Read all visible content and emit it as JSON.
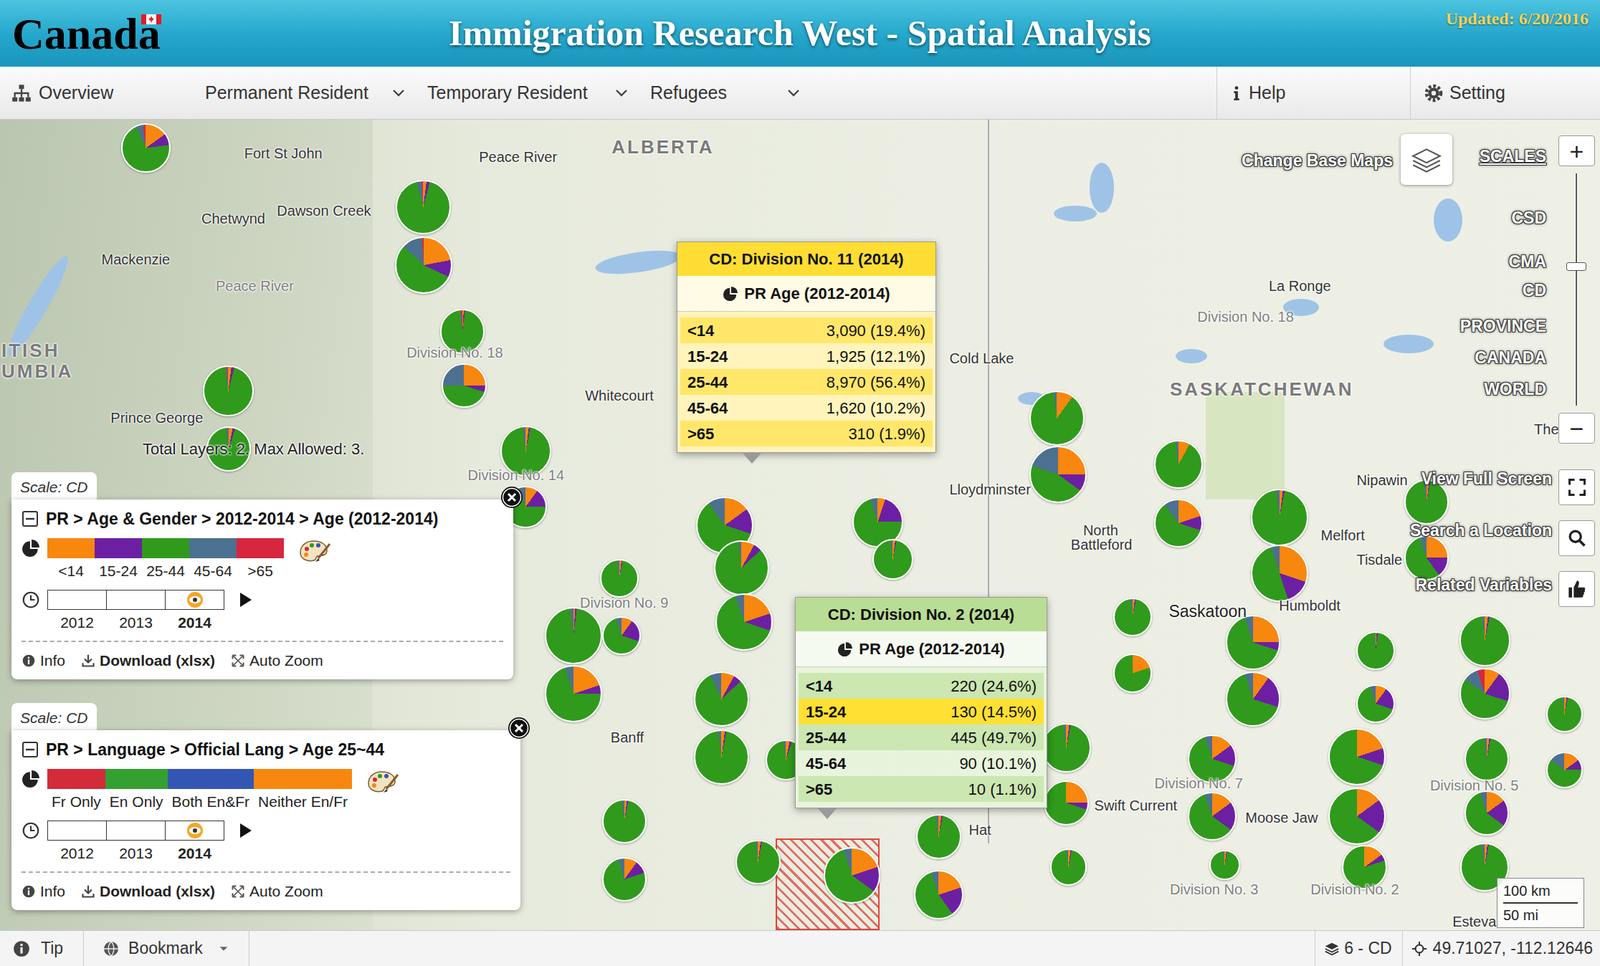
{
  "header": {
    "logo": "Canada",
    "title": "Immigration Research West - Spatial Analysis",
    "updated": "Updated: 6/20/2016"
  },
  "nav": {
    "items": [
      {
        "label": "Overview",
        "dropdown": false
      },
      {
        "label": "Permanent Resident",
        "dropdown": true
      },
      {
        "label": "Temporary Resident",
        "dropdown": true
      },
      {
        "label": "Refugees",
        "dropdown": true
      }
    ],
    "help": "Help",
    "setting": "Setting"
  },
  "map": {
    "labels": [
      {
        "text": "ALBERTA",
        "kind": "province"
      },
      {
        "text": "SASKATCHEWAN",
        "kind": "province"
      },
      {
        "text": "ITISH",
        "kind": "province"
      },
      {
        "text": "UMBIA",
        "kind": "province"
      },
      {
        "text": "Fort St John",
        "kind": "city"
      },
      {
        "text": "Peace River",
        "kind": "city"
      },
      {
        "text": "Chetwynd",
        "kind": "city"
      },
      {
        "text": "Dawson Creek",
        "kind": "city"
      },
      {
        "text": "Mackenzie",
        "kind": "city"
      },
      {
        "text": "Peace River",
        "kind": "division"
      },
      {
        "text": "Division No. 18",
        "kind": "division"
      },
      {
        "text": "Whitecourt",
        "kind": "city"
      },
      {
        "text": "Prince George",
        "kind": "city"
      },
      {
        "text": "Division No. 14",
        "kind": "division"
      },
      {
        "text": "Cold Lake",
        "kind": "city"
      },
      {
        "text": "La Ronge",
        "kind": "city"
      },
      {
        "text": "Division No. 18",
        "kind": "division"
      },
      {
        "text": "Lloydminster",
        "kind": "city"
      },
      {
        "text": "North",
        "kind": "city"
      },
      {
        "text": "Battleford",
        "kind": "city"
      },
      {
        "text": "Nipawin",
        "kind": "city"
      },
      {
        "text": "Melfort",
        "kind": "city"
      },
      {
        "text": "Tisdale",
        "kind": "city"
      },
      {
        "text": "Humboldt",
        "kind": "city"
      },
      {
        "text": "Saskatoon",
        "kind": "major"
      },
      {
        "text": "Division No. 9",
        "kind": "division"
      },
      {
        "text": "Division No. 7",
        "kind": "division"
      },
      {
        "text": "Swift Current",
        "kind": "city"
      },
      {
        "text": "Moose Jaw",
        "kind": "city"
      },
      {
        "text": "Division No. 3",
        "kind": "division"
      },
      {
        "text": "Division No. 2",
        "kind": "division"
      },
      {
        "text": "Division No. 5",
        "kind": "division"
      },
      {
        "text": "Hat",
        "kind": "city"
      },
      {
        "text": "Esteva",
        "kind": "city"
      },
      {
        "text": "Banff",
        "kind": "city"
      },
      {
        "text": "The",
        "kind": "city"
      }
    ],
    "pies": [
      {
        "values": [
          15,
          8,
          70,
          5,
          2
        ]
      },
      {
        "values": [
          2,
          2,
          92,
          3,
          1
        ]
      },
      {
        "values": [
          22,
          10,
          55,
          12,
          1
        ]
      },
      {
        "values": [
          1,
          1,
          96,
          1,
          1
        ]
      },
      {
        "values": [
          25,
          5,
          45,
          25,
          0
        ]
      },
      {
        "values": [
          2,
          2,
          94,
          1,
          1
        ]
      },
      {
        "values": [
          3,
          2,
          93,
          2,
          0
        ]
      },
      {
        "values": [
          2,
          1,
          95,
          2,
          0
        ]
      },
      {
        "values": [
          10,
          15,
          70,
          5,
          0
        ]
      },
      {
        "values": [
          15,
          15,
          60,
          10,
          0
        ]
      },
      {
        "values": [
          8,
          5,
          85,
          2,
          0
        ]
      },
      {
        "values": [
          20,
          10,
          65,
          5,
          0
        ]
      },
      {
        "values": [
          5,
          20,
          70,
          5,
          0
        ]
      },
      {
        "values": [
          2,
          1,
          95,
          2,
          0
        ]
      },
      {
        "values": [
          2,
          1,
          95,
          2,
          0
        ]
      },
      {
        "values": [
          1,
          1,
          96,
          2,
          0
        ]
      },
      {
        "values": [
          10,
          20,
          65,
          5,
          0
        ]
      },
      {
        "values": [
          20,
          5,
          70,
          5,
          0
        ]
      },
      {
        "values": [
          8,
          5,
          80,
          7,
          0
        ]
      },
      {
        "values": [
          2,
          1,
          95,
          2,
          0
        ]
      },
      {
        "values": [
          3,
          2,
          93,
          2,
          0
        ]
      },
      {
        "values": [
          10,
          0,
          88,
          2,
          0
        ]
      },
      {
        "values": [
          25,
          10,
          45,
          20,
          0
        ]
      },
      {
        "values": [
          8,
          0,
          90,
          2,
          0
        ]
      },
      {
        "values": [
          20,
          10,
          60,
          10,
          0
        ]
      },
      {
        "values": [
          2,
          1,
          95,
          2,
          0
        ]
      },
      {
        "values": [
          30,
          15,
          50,
          5,
          0
        ]
      },
      {
        "values": [
          2,
          1,
          95,
          2,
          0
        ]
      },
      {
        "values": [
          25,
          15,
          55,
          5,
          0
        ]
      },
      {
        "values": [
          2,
          1,
          95,
          2,
          0
        ]
      },
      {
        "values": [
          20,
          0,
          80,
          0,
          0
        ]
      },
      {
        "values": [
          25,
          5,
          65,
          5,
          0
        ]
      },
      {
        "values": [
          10,
          20,
          65,
          5,
          0
        ]
      },
      {
        "values": [
          1,
          1,
          97,
          1,
          0
        ]
      },
      {
        "values": [
          10,
          20,
          65,
          5,
          0
        ]
      },
      {
        "values": [
          2,
          1,
          95,
          2,
          0
        ]
      },
      {
        "values": [
          10,
          20,
          55,
          10,
          5
        ]
      },
      {
        "values": [
          2,
          1,
          95,
          2,
          0
        ]
      },
      {
        "values": [
          15,
          10,
          60,
          15,
          0
        ]
      },
      {
        "values": [
          2,
          1,
          95,
          2,
          0
        ]
      },
      {
        "values": [
          25,
          5,
          70,
          0,
          0
        ]
      },
      {
        "values": [
          15,
          15,
          65,
          5,
          0
        ]
      },
      {
        "values": [
          15,
          20,
          60,
          5,
          0
        ]
      },
      {
        "values": [
          20,
          10,
          70,
          0,
          0
        ]
      },
      {
        "values": [
          15,
          20,
          65,
          0,
          0
        ]
      },
      {
        "values": [
          2,
          1,
          95,
          2,
          0
        ]
      },
      {
        "values": [
          15,
          20,
          60,
          5,
          0
        ]
      },
      {
        "values": [
          2,
          1,
          95,
          2,
          0
        ]
      },
      {
        "values": [
          15,
          5,
          80,
          0,
          0
        ]
      },
      {
        "values": [
          2,
          1,
          95,
          2,
          0
        ]
      },
      {
        "values": [
          2,
          1,
          95,
          2,
          0
        ]
      },
      {
        "values": [
          2,
          1,
          95,
          2,
          0
        ]
      },
      {
        "values": [
          20,
          20,
          55,
          5,
          0
        ]
      },
      {
        "values": [
          20,
          15,
          60,
          5,
          0
        ]
      },
      {
        "values": [
          2,
          1,
          95,
          2,
          0
        ]
      },
      {
        "values": [
          10,
          10,
          75,
          5,
          0
        ]
      },
      {
        "values": [
          2,
          1,
          95,
          2,
          0
        ]
      }
    ],
    "total_layers": "Total Layers: 2. Max Allowed: 3."
  },
  "tooltips": [
    {
      "title": "CD: Division No. 11 (2014)",
      "subtitle": "PR Age (2012-2014)",
      "color": "#ffdd33",
      "rows": [
        {
          "label": "<14",
          "value": "3,090 (19.4%)",
          "selected": false
        },
        {
          "label": "15-24",
          "value": "1,925 (12.1%)",
          "selected": false
        },
        {
          "label": "25-44",
          "value": "8,970 (56.4%)",
          "selected": false
        },
        {
          "label": "45-64",
          "value": "1,620 (10.2%)",
          "selected": false
        },
        {
          "label": ">65",
          "value": "310 (1.9%)",
          "selected": false
        }
      ]
    },
    {
      "title": "CD: Division No. 2 (2014)",
      "subtitle": "PR Age (2012-2014)",
      "color": "#b9dd94",
      "rows": [
        {
          "label": "<14",
          "value": "220 (24.6%)",
          "selected": false
        },
        {
          "label": "15-24",
          "value": "130 (14.5%)",
          "selected": true
        },
        {
          "label": "25-44",
          "value": "445 (49.7%)",
          "selected": false
        },
        {
          "label": "45-64",
          "value": "90 (10.1%)",
          "selected": false
        },
        {
          "label": ">65",
          "value": "10 (1.1%)",
          "selected": false
        }
      ]
    }
  ],
  "layers": [
    {
      "scale": "Scale: CD",
      "title": "PR > Age & Gender > 2012-2014 > Age (2012-2014)",
      "expanded": true,
      "legend": [
        {
          "label": "<14",
          "color": "#f7870f"
        },
        {
          "label": "15-24",
          "color": "#6d1fa3"
        },
        {
          "label": "25-44",
          "color": "#2f9a1b"
        },
        {
          "label": "45-64",
          "color": "#4c7090"
        },
        {
          "label": ">65",
          "color": "#d7263d"
        }
      ],
      "years": [
        {
          "label": "2012",
          "selected": false
        },
        {
          "label": "2013",
          "selected": false
        },
        {
          "label": "2014",
          "selected": true
        }
      ],
      "actions": [
        "Info",
        "Download (xlsx)",
        "Auto Zoom"
      ]
    },
    {
      "scale": "Scale: CD",
      "title": "PR > Language > Official Lang > Age 25~44",
      "expanded": true,
      "legend": [
        {
          "label": "Fr Only",
          "color": "#d42b3a"
        },
        {
          "label": "En Only",
          "color": "#34a030"
        },
        {
          "label": "Both En&Fr",
          "color": "#3356b5"
        },
        {
          "label": "Neither En/Fr",
          "color": "#f7870f"
        }
      ],
      "years": [
        {
          "label": "2012",
          "selected": false
        },
        {
          "label": "2013",
          "selected": false
        },
        {
          "label": "2014",
          "selected": true
        }
      ],
      "actions": [
        "Info",
        "Download (xlsx)",
        "Auto Zoom"
      ]
    }
  ],
  "controls": {
    "scales_title": "SCALES",
    "scales": [
      "CSD",
      "CMA",
      "CD",
      "PROVINCE",
      "CANADA",
      "WORLD"
    ],
    "zoom_in": "+",
    "zoom_out": "−",
    "zoom_level": 0.6,
    "base_maps": "Change Base Maps",
    "full_screen": "View Full Screen",
    "search": "Search a Location",
    "related": "Related Variables"
  },
  "scale_bar": {
    "km": "100 km",
    "mi": "50 mi"
  },
  "status_bar": {
    "tip": "Tip",
    "bookmark": "Bookmark",
    "layers": "6 - CD",
    "coords": "49.71027, -112.12646"
  }
}
